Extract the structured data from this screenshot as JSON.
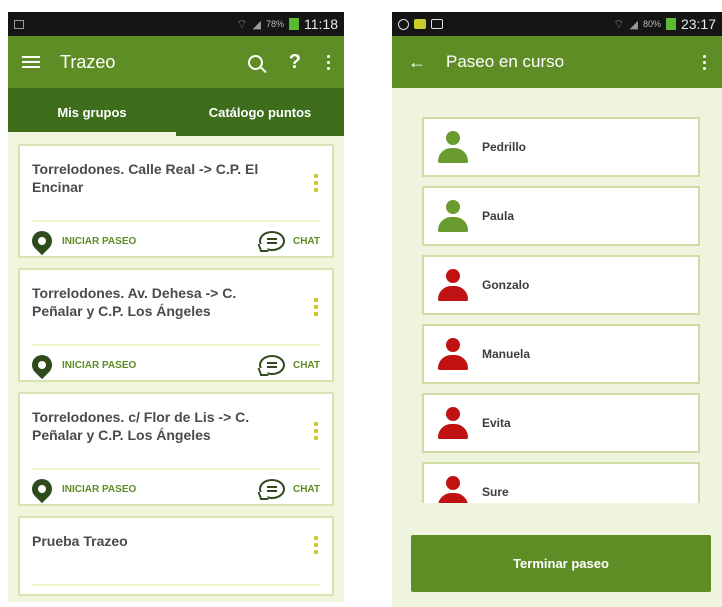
{
  "left": {
    "status": {
      "battery": "78%",
      "time": "11:18"
    },
    "app_title": "Trazeo",
    "help_label": "?",
    "tabs": [
      {
        "label": "Mis grupos"
      },
      {
        "label": "Catálogo puntos"
      }
    ],
    "cards": [
      {
        "title": "Torrelodones. Calle Real -> C.P. El Encinar",
        "start_label": "INICIAR PASEO",
        "chat_label": "CHAT"
      },
      {
        "title": "Torrelodones. Av. Dehesa -> C. Peñalar y C.P. Los Ángeles",
        "start_label": "INICIAR PASEO",
        "chat_label": "CHAT"
      },
      {
        "title": "Torrelodones. c/ Flor de Lis -> C. Peñalar y C.P. Los Ángeles",
        "start_label": "INICIAR PASEO",
        "chat_label": "CHAT"
      },
      {
        "title": "Prueba Trazeo"
      }
    ]
  },
  "right": {
    "status": {
      "battery": "80%",
      "time": "23:17"
    },
    "title": "Paseo en curso",
    "back_glyph": "←",
    "people": [
      {
        "name": "Pedrillo",
        "status_color": "#6a9b2f"
      },
      {
        "name": "Paula",
        "status_color": "#6a9b2f"
      },
      {
        "name": "Gonzalo",
        "status_color": "#c01212"
      },
      {
        "name": "Manuela",
        "status_color": "#c01212"
      },
      {
        "name": "Evita",
        "status_color": "#c01212"
      },
      {
        "name": "Sure",
        "status_color": "#c01212"
      }
    ],
    "finish_label": "Terminar paseo"
  }
}
